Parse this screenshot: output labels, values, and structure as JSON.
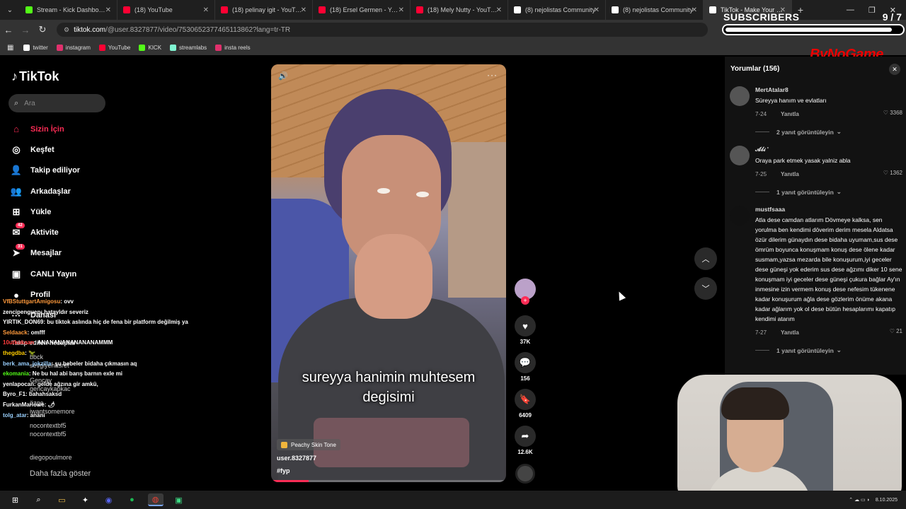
{
  "browser": {
    "tabs": [
      {
        "label": "Stream - Kick Dashboard",
        "color": "#53fc18"
      },
      {
        "label": "(18) YouTube",
        "color": "#ff0033"
      },
      {
        "label": "(18) pelinay igit - YouTube",
        "color": "#ff0033"
      },
      {
        "label": "(18) Ersel Germen - YouTube",
        "color": "#ff0033"
      },
      {
        "label": "(18) Mely Nutty - YouTube",
        "color": "#ff0033"
      },
      {
        "label": "(8) nejolistas Community",
        "color": "#ffffff"
      },
      {
        "label": "(8) nejolistas Community",
        "color": "#ffffff"
      },
      {
        "label": "TikTok - Make Your Day",
        "color": "#ffffff"
      }
    ],
    "new_tab": "+",
    "window_controls": [
      "—",
      "❐",
      "✕"
    ],
    "url_host": "tiktok.com",
    "url_path": "/@user.8327877/video/7530652377465113862?lang=tr-TR",
    "bookmarks": [
      {
        "label": "twitter",
        "color": "#ffffff"
      },
      {
        "label": "instagram",
        "color": "#e1306c"
      },
      {
        "label": "YouTube",
        "color": "#ff0033"
      },
      {
        "label": "KICK",
        "color": "#53fc18"
      },
      {
        "label": "streamlabs",
        "color": "#80f5d2"
      },
      {
        "label": "insta reels",
        "color": "#e1306c"
      }
    ]
  },
  "overlay": {
    "subscribers_title": "SUBSCRIBERS",
    "subscribers_count": "9 / 7",
    "subscribers_progress": 0.94,
    "brand": "ByNoGame"
  },
  "tiktok": {
    "logo": "TikTok",
    "search_placeholder": "Ara",
    "nav": [
      {
        "label": "Sizin İçin",
        "icon": "home-icon",
        "active": true
      },
      {
        "label": "Keşfet",
        "icon": "compass-icon"
      },
      {
        "label": "Takip ediliyor",
        "icon": "following-icon"
      },
      {
        "label": "Arkadaşlar",
        "icon": "friends-icon"
      },
      {
        "label": "Yükle",
        "icon": "upload-icon"
      },
      {
        "label": "Aktivite",
        "icon": "activity-icon",
        "badge": "42"
      },
      {
        "label": "Mesajlar",
        "icon": "messages-icon",
        "badge": "31"
      },
      {
        "label": "CANLI Yayın",
        "icon": "live-icon"
      },
      {
        "label": "Profil",
        "icon": "profile-icon"
      },
      {
        "label": "Dahası",
        "icon": "more-icon"
      }
    ],
    "following_title": "Takip edilen hesaplar",
    "following_ghosts": [
      "bbck",
      "sevgiyehasret",
      "Gencay",
      "gencaykapkac",
      "özge",
      "iwantsomemore",
      "nocontextbf5",
      "nocontextbf5",
      "diegopoulmore",
      "Daha fazla göster"
    ],
    "video": {
      "caption_line1": "sureyya hanimin muhtesem",
      "caption_line2": "degisimi",
      "sound": "Peachy Skin Tone",
      "username": "user.8327877",
      "hashtag": "#fyp",
      "progress": 0.16
    },
    "actions": {
      "likes": "37K",
      "comments": "156",
      "saves": "6409",
      "shares": "12.6K"
    },
    "comments_header": "Yorumlar (156)",
    "comments": [
      {
        "name": "MertAtalar8",
        "text": "Süreyya hanım ve evlatları",
        "date": "7-24",
        "reply": "Yanıtla",
        "likes": "3368",
        "replies": "2 yanıt görüntüleyin"
      },
      {
        "name": "𝓐𝓵𝓲 '",
        "text": "Oraya park etmek yasak yalniz abla",
        "date": "7-25",
        "reply": "Yanıtla",
        "likes": "1362",
        "replies": "1 yanıt görüntüleyin"
      },
      {
        "name": "mustfsaaa",
        "text": "Atla dese camdan atlarım Dövmeye kalksa, sen yorulma ben kendimi döverim derim mesela Aldatsa özür dilerim günaydın dese bidaha uyumam,sus dese ömrüm boyunca konuşmam konuş dese ölene kadar susmam,yazsa mezarda bile konuşurum,iyi geceler dese güneşi yok ederim sus dese ağzımı diker 10 sene konuşmam iyi geceler dese güneşi çukura bağlar Ay'ın inmesine izin vermem konuş dese nefesim tükenene kadar konuşurum ağla dese gözlerim önüme akana kadar ağlarım yok ol dese bütün hesaplarımı kapatıp kendimi atarım",
        "date": "7-27",
        "reply": "Yanıtla",
        "likes": "21",
        "replies": "1 yanıt görüntüleyin"
      }
    ]
  },
  "chat": [
    {
      "user": "VfBStuttgartAmigosu",
      "msg": ": ovv",
      "color": "#ff9a3c"
    },
    {
      "user": "zencipenguen",
      "msg": ": hatayldır severiz",
      "color": "#ffffff"
    },
    {
      "user": "YIRTIK_DON69",
      "msg": ": bu tiktok aslında hiç de fena bir platform değilmiş ya",
      "color": "#ffffff"
    },
    {
      "user": "Seldaack",
      "msg": ": omfff",
      "color": "#ff9a3c"
    },
    {
      "user": "10utkukaan",
      "msg": ": ANANANANANANANAMMM",
      "color": "#ff3b3b"
    },
    {
      "user": "thegdba",
      "msg": ": 🦖",
      "color": "#ffcc00"
    },
    {
      "user": "berk_ama_jokzilla",
      "msg": ": şu bebeler bidaha çıkmasın aq",
      "color": "#9ad0ff"
    },
    {
      "user": "ekomania",
      "msg": ": Ne bu hal abi barış barnın exle mi",
      "color": "#53fc18"
    },
    {
      "user": "yenlapocan",
      "msg": ": gelde ağzına gir amkü,",
      "color": "#ffffff"
    },
    {
      "user": "Byro_F1",
      "msg": ": bahahsaksd",
      "color": "#ffffff"
    },
    {
      "user": "FurkanMarlowe",
      "msg": ": 🌶",
      "color": "#ffffff"
    },
    {
      "user": "tolg_atar",
      "msg": ": ananı",
      "color": "#9ad0ff"
    }
  ],
  "taskbar": {
    "icons": [
      "windows-icon",
      "search-icon",
      "folder-icon",
      "app-icon",
      "discord-icon",
      "spotify-icon",
      "chrome-icon",
      "app2-icon"
    ],
    "date": "8.10.2025"
  }
}
